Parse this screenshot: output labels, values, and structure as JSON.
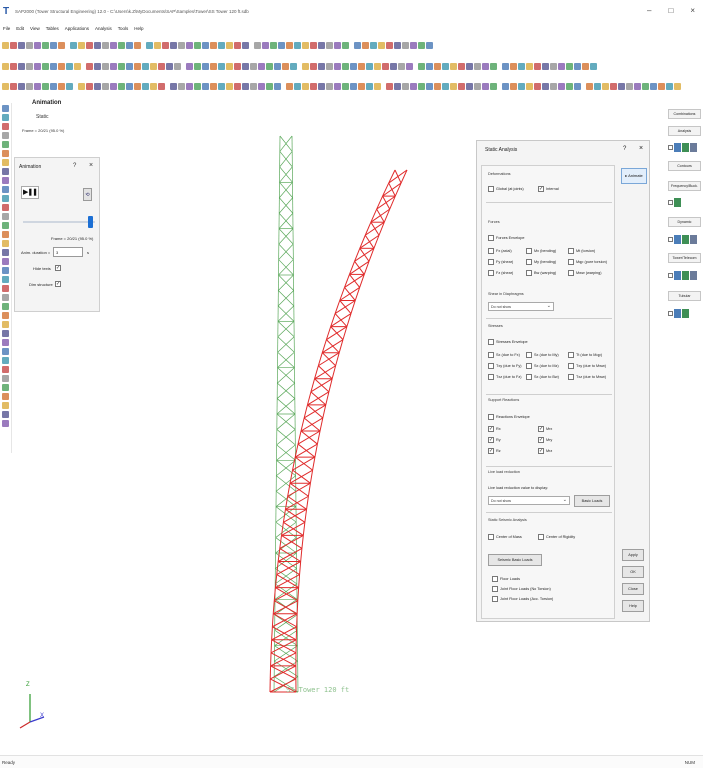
{
  "window": {
    "title": "SAP2000 (Tower Structural Engineering) 12.0 - C:\\Users\\k.Z\\MyDocuments\\SAP\\Samples\\Tower\\SS Tower 120 ft.sdb",
    "icon_letter": "T",
    "minimize": "–",
    "maximize": "□",
    "close": "×"
  },
  "menu": [
    "File",
    "Edit",
    "View",
    "Tables",
    "Applications",
    "Analysis",
    "Tools",
    "Help"
  ],
  "view": {
    "title": "Animation",
    "subtitle": "Static",
    "frame_text": "Frame = 20/21 (95.0 %)"
  },
  "animation_panel": {
    "title": "Animation",
    "help": "?",
    "close": "×",
    "play_label": "▶❚❚",
    "reset_label": "⟲",
    "frame_text": "Frame = 20/21 (95.0 %)",
    "duration_label": "Anim. duration =",
    "duration_value": "3",
    "duration_unit": "s",
    "hide_texts_label": "Hide texts",
    "hide_texts_checked": "✓",
    "dim_structure_label": "Dim structure",
    "dim_structure_checked": "✓",
    "slider_position": 0.95
  },
  "static_analysis": {
    "title": "Static Analysis",
    "help": "?",
    "close": "×",
    "animate_label": "Animate",
    "deformations_head": "Deformations",
    "deform_global": "Global (at joints)",
    "deform_internal": "Internal",
    "deform_internal_checked": "✓",
    "forces_head": "Forces",
    "forces_envelope": "Forces Envelope",
    "forces": [
      "Fx (axial)",
      "Mx (bending)",
      "Mt (torsion)",
      "Fy (shear)",
      "My (bending)",
      "Mqp (pure torsion)",
      "Fz (shear)",
      "Bw (warping)",
      "Mww (warping)"
    ],
    "shear_head": "Shear in Diaphragms",
    "shear_select": "Do not show",
    "stresses_head": "Stresses",
    "stresses_envelope": "Stresses Envelope",
    "stresses": [
      "Sx (due to Fx)",
      "Sx (due to My)",
      "Tt (due to Mqp)",
      "Txy (due to Fy)",
      "Sx (due to Mz)",
      "Txy (due to Mww)",
      "Txz (due to Fz)",
      "Sx (due to Bw)",
      "Txz (due to Mww)"
    ],
    "reactions_head": "Support Reactions",
    "reactions_envelope": "Reactions Envelope",
    "reactions": [
      "Rx",
      "Mrx",
      "Ry",
      "Mry",
      "Rz",
      "Mrz"
    ],
    "reactions_checked": "✓",
    "live_head": "Live load reduction",
    "live_label": "Live load reduction value to display:",
    "live_select": "Do not show",
    "basic_loads_button": "Basic Loads",
    "seismic_head": "Static Seismic Analysis",
    "center_mass": "Center of Mass",
    "center_rigidity": "Center of Rigidity",
    "seismic_button": "Seismic Basic Loads",
    "floor_loads": "Floor Loads",
    "story_floor": "Joint Floor Loads (No Torsion)",
    "story_floor_acc": "Joint Floor Loads (Acc. Torsion)",
    "buttons": [
      "Apply",
      "OK",
      "Close",
      "Help"
    ]
  },
  "right_panel": {
    "combinations": "Combinations",
    "analysis": "Analysis",
    "contours": "Contours",
    "frequency": "Frequency/Buck.",
    "dynamic": "Dynamic",
    "tower": "Tower/Telecom",
    "tubular": "Tubular"
  },
  "structure_label": "SS Tower 120 ft",
  "axes": {
    "z": "Z",
    "x": "X"
  },
  "status": {
    "left": "Ready",
    "right": "NUM"
  },
  "colors": {
    "deformed": "#e02b2b",
    "undeformed": "#5aa85a",
    "accent": "#1c6fd4"
  }
}
